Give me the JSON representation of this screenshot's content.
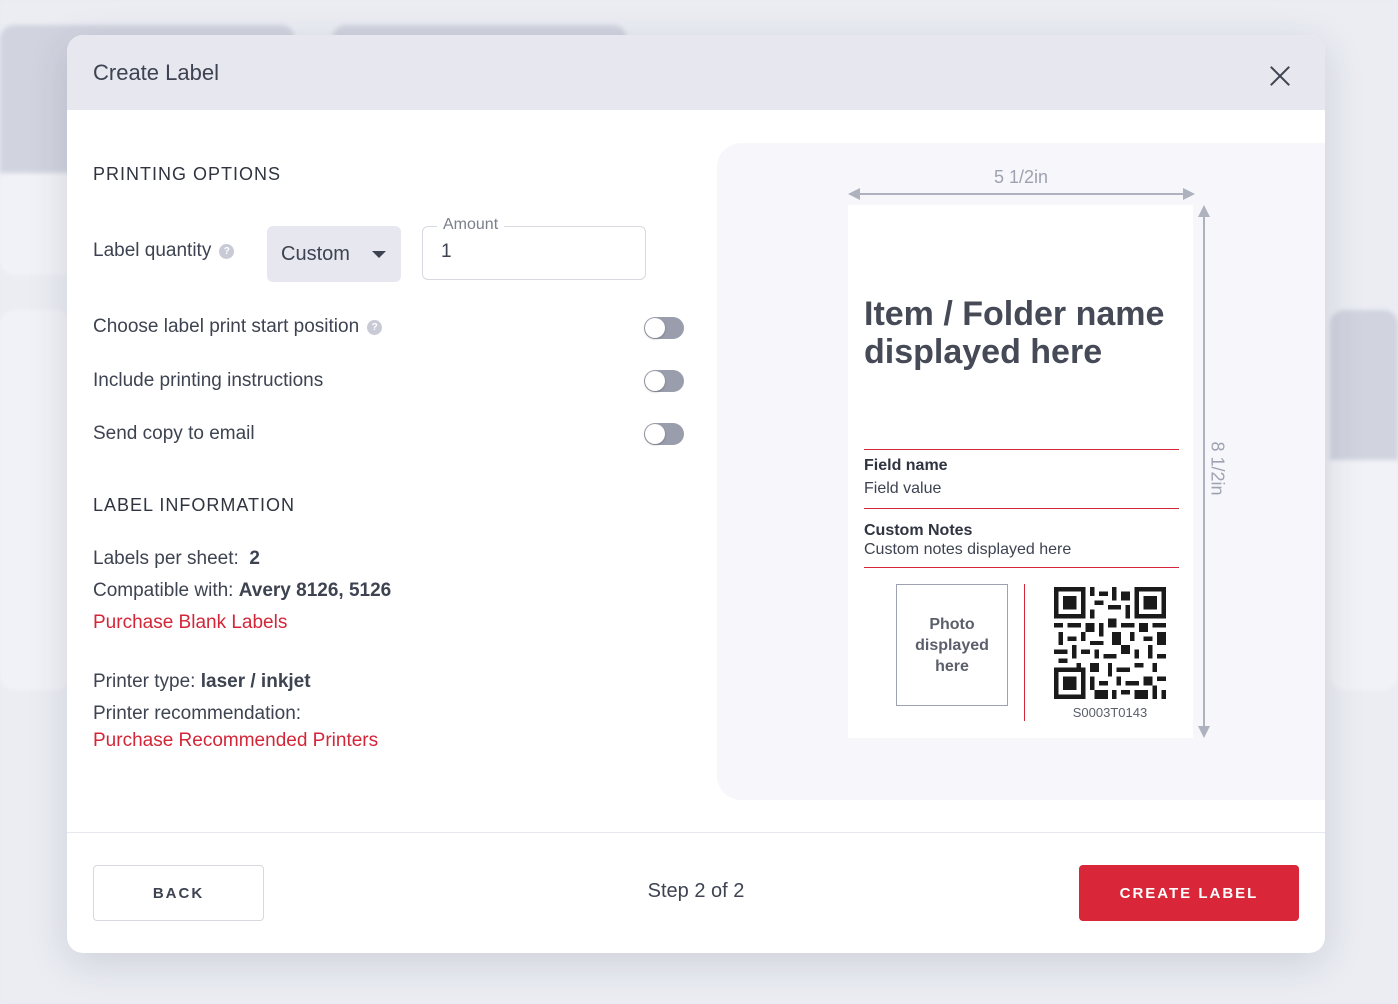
{
  "modal": {
    "title": "Create Label",
    "close_icon": "close-icon"
  },
  "printing_options": {
    "title": "PRINTING OPTIONS",
    "label_quantity": {
      "label": "Label quantity",
      "select_value": "Custom",
      "amount_label": "Amount",
      "amount_value": "1"
    },
    "toggles": [
      {
        "label": "Choose label print start position",
        "help": true,
        "on": false
      },
      {
        "label": "Include printing instructions",
        "help": false,
        "on": false
      },
      {
        "label": "Send copy to email",
        "help": false,
        "on": false
      }
    ]
  },
  "label_information": {
    "title": "LABEL INFORMATION",
    "labels_per_sheet_label": "Labels per sheet:",
    "labels_per_sheet_value": "2",
    "compatible_label": "Compatible with:",
    "compatible_value": "Avery 8126, 5126",
    "purchase_blank_labels": "Purchase Blank Labels",
    "printer_type_label": "Printer type:",
    "printer_type_value": "laser / inkjet",
    "printer_recommendation_label": "Printer recommendation:",
    "purchase_printers": "Purchase Recommended Printers"
  },
  "preview": {
    "width_dim": "5 1/2in",
    "height_dim": "8 1/2in",
    "item_name": "Item / Folder name displayed here",
    "field_name": "Field name",
    "field_value": "Field value",
    "notes_name": "Custom Notes",
    "notes_value": "Custom notes displayed here",
    "photo_text": "Photo displayed here",
    "qr_code_value": "S0003T0143"
  },
  "footer": {
    "back_label": "BACK",
    "step_text": "Step 2 of 2",
    "create_label": "CREATE LABEL"
  },
  "colors": {
    "accent": "#d92638",
    "header_bg": "#e6e7ef",
    "text": "#3d4350"
  }
}
